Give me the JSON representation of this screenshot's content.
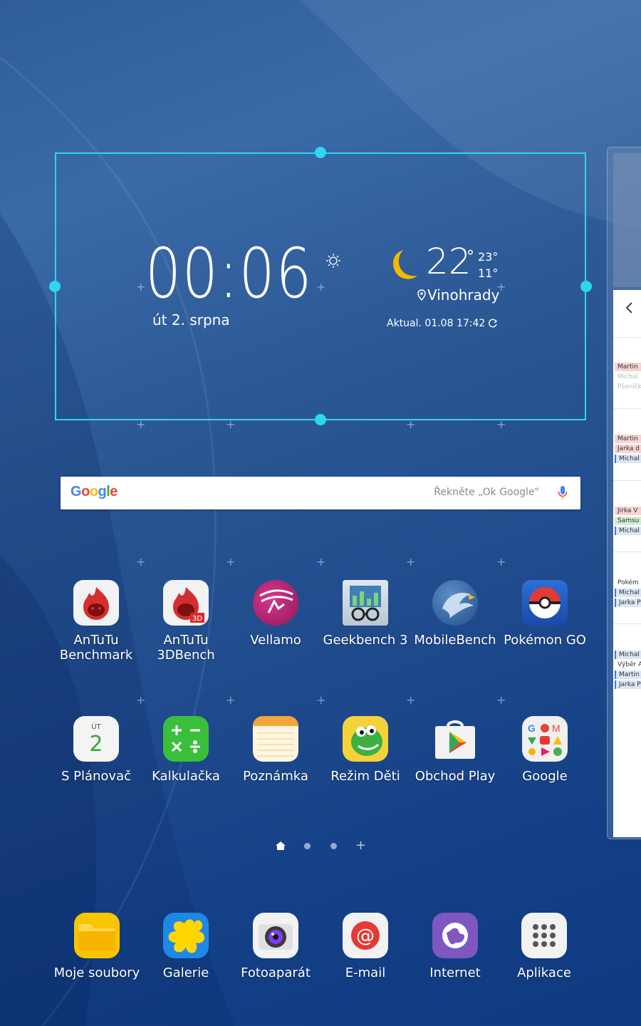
{
  "widget": {
    "time": "00:06",
    "date": "út 2. srpna",
    "temperature": "22",
    "temp_unit": "°",
    "temp_high": "23°",
    "temp_low": "11°",
    "location": "Vinohrady",
    "updated": "Aktual. 01.08 17:42"
  },
  "search": {
    "logo": "Google",
    "hint": "Řekněte „Ok Google\""
  },
  "apps_row1": [
    {
      "label": "AnTuTu\nBenchmark",
      "icon": "antutu-icon"
    },
    {
      "label": "AnTuTu\n3DBench",
      "icon": "antutu-3d-icon"
    },
    {
      "label": "Vellamo",
      "icon": "vellamo-icon"
    },
    {
      "label": "Geekbench 3",
      "icon": "geekbench-icon"
    },
    {
      "label": "MobileBench",
      "icon": "mobilebench-icon"
    },
    {
      "label": "Pokémon GO",
      "icon": "pokeball-icon"
    }
  ],
  "apps_row2": [
    {
      "label": "S Plánovač",
      "icon": "calendar-icon",
      "badge_day": "ÚT",
      "badge_num": "2"
    },
    {
      "label": "Kalkulačka",
      "icon": "calculator-icon"
    },
    {
      "label": "Poznámka",
      "icon": "notes-icon"
    },
    {
      "label": "Režim Děti",
      "icon": "kids-mode-icon"
    },
    {
      "label": "Obchod Play",
      "icon": "play-store-icon"
    },
    {
      "label": "Google",
      "icon": "google-folder-icon"
    }
  ],
  "dock": [
    {
      "label": "Moje soubory",
      "icon": "folder-icon"
    },
    {
      "label": "Galerie",
      "icon": "gallery-icon"
    },
    {
      "label": "Fotoaparát",
      "icon": "camera-icon"
    },
    {
      "label": "E-mail",
      "icon": "email-icon"
    },
    {
      "label": "Internet",
      "icon": "internet-icon"
    },
    {
      "label": "Aplikace",
      "icon": "apps-grid-icon"
    }
  ],
  "side_calendar": {
    "entries": [
      "Martin",
      "Michal",
      "Pšeničk",
      "Martin",
      "Jarka d",
      "Michal",
      "Jirka V",
      "Samsu",
      "Michal",
      "Pokém",
      "Michal",
      "Jarka P",
      "Michal",
      "Výběr A",
      "Martin",
      "Jarka P"
    ]
  },
  "colors": {
    "selection": "#2fd6f0",
    "sun": "#f5b800"
  }
}
